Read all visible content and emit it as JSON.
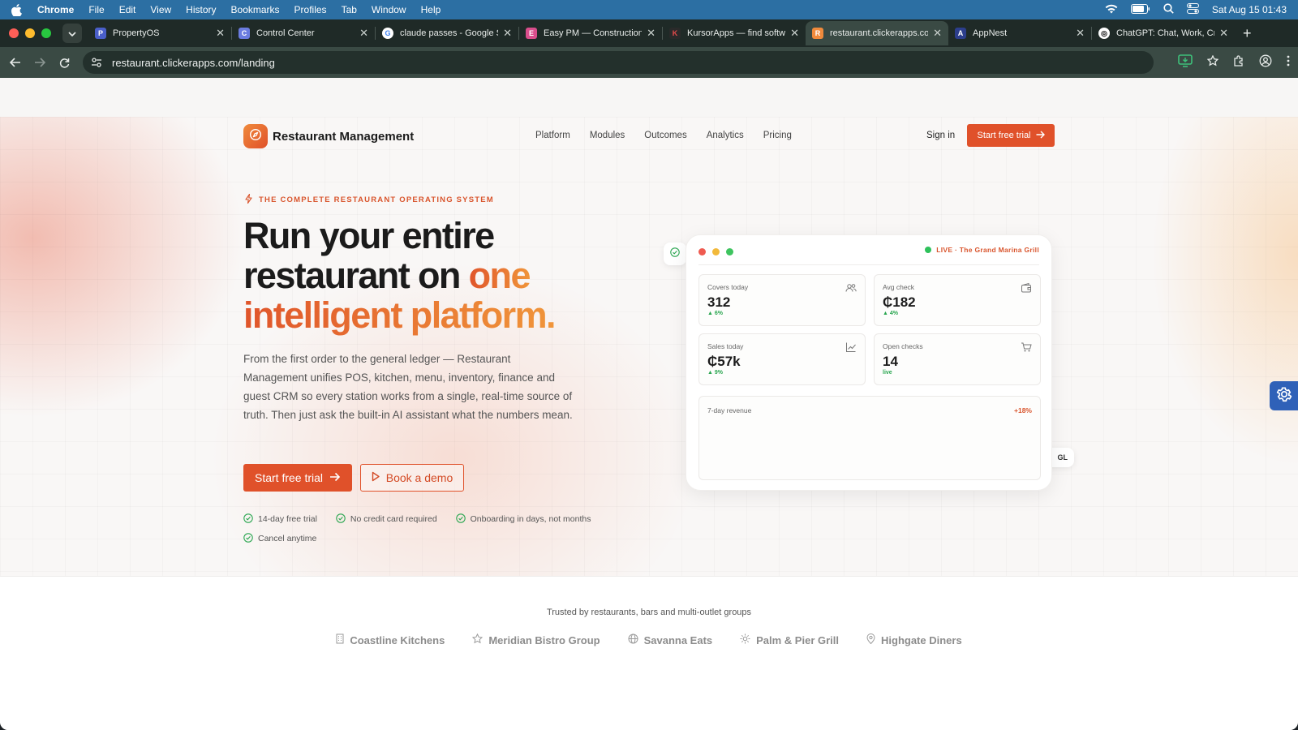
{
  "menubar": {
    "app": "Chrome",
    "items": [
      "File",
      "Edit",
      "View",
      "History",
      "Bookmarks",
      "Profiles",
      "Tab",
      "Window",
      "Help"
    ],
    "clock": "Sat Aug 15  01:43"
  },
  "tabs": [
    {
      "title": "PropertyOS",
      "color": "#4a5fc9",
      "glyph": "P"
    },
    {
      "title": "Control Center",
      "color": "#6b7ce0",
      "glyph": "C"
    },
    {
      "title": "claude passes - Google S",
      "color": "#ffffff",
      "glyph": "G"
    },
    {
      "title": "Easy PM — Construction",
      "color": "#d94e8c",
      "glyph": "E"
    },
    {
      "title": "KursorApps — find softw",
      "color": "#2a2a2a",
      "glyph": "K"
    },
    {
      "title": "restaurant.clickerapps.co",
      "color": "#f08a3c",
      "glyph": "R"
    },
    {
      "title": "AppNest",
      "color": "#2c3e8c",
      "glyph": "A"
    },
    {
      "title": "ChatGPT: Chat, Work, Cr",
      "color": "#ffffff",
      "glyph": "◎"
    }
  ],
  "address": {
    "url": "restaurant.clickerapps.com/landing"
  },
  "site": {
    "brand": "Restaurant Management",
    "nav": [
      "Platform",
      "Modules",
      "Outcomes",
      "Analytics",
      "Pricing"
    ],
    "signin": "Sign in",
    "nav_cta": "Start free trial",
    "accent": "#e0512a"
  },
  "hero": {
    "eyebrow": "THE COMPLETE RESTAURANT OPERATING SYSTEM",
    "headline_1": "Run your entire",
    "headline_2": "restaurant on ",
    "headline_accent_1": "one",
    "headline_accent_2": "intelligent platform.",
    "lede": "From the first order to the general ledger — Restaurant Management unifies POS, kitchen, menu, inventory, finance and guest CRM so every station works from a single, real-time source of truth. Then just ask the built-in AI assistant what the numbers mean.",
    "cta_primary": "Start free trial",
    "cta_secondary": "Book a demo",
    "perks": [
      "14-day free trial",
      "No credit card required",
      "Onboarding in days, not months",
      "Cancel anytime"
    ]
  },
  "dashboard": {
    "live_label": "LIVE · The Grand Marina Grill",
    "kpis": [
      {
        "label": "Covers today",
        "value": "312",
        "delta": "▲ 6%",
        "icon": "users-icon"
      },
      {
        "label": "Avg check",
        "value": "₵182",
        "delta": "▲ 4%",
        "icon": "wallet-icon"
      },
      {
        "label": "Sales today",
        "value": "₵57k",
        "delta": "▲ 9%",
        "icon": "chart-up-icon"
      },
      {
        "label": "Open checks",
        "value": "14",
        "delta": "live",
        "icon": "cart-icon"
      }
    ],
    "revenue_label": "7-day revenue",
    "revenue_change": "+18%",
    "badge_gl": "GL"
  },
  "trusted": {
    "caption": "Trusted by restaurants, bars and multi-outlet groups",
    "companies": [
      "Coastline Kitchens",
      "Meridian Bistro Group",
      "Savanna Eats",
      "Palm & Pier Grill",
      "Highgate Diners"
    ]
  }
}
